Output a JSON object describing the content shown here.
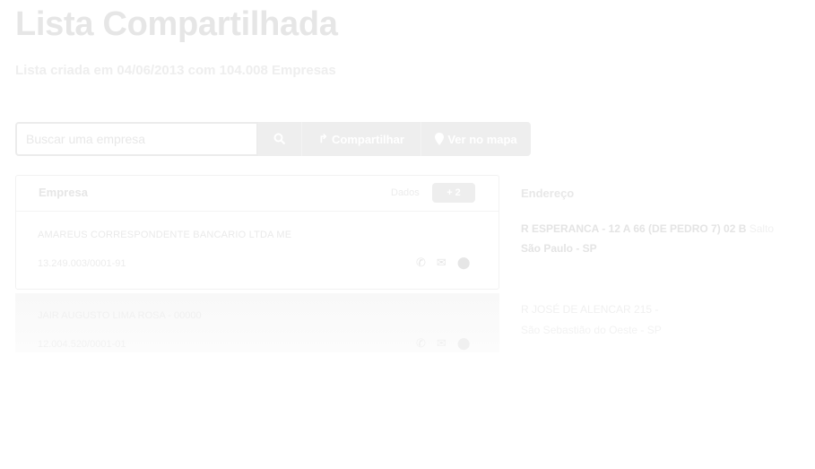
{
  "header": {
    "title": "Lista Compartilhada",
    "subtitle": "Lista criada em 04/06/2013 com 104.008 Empresas"
  },
  "toolbar": {
    "search_placeholder": "Buscar uma empresa",
    "search_icon": "search-icon",
    "share_label": "Compartilhar",
    "share_icon": "share-icon",
    "map_label": "Ver no mapa",
    "map_icon": "map-marker-icon"
  },
  "table": {
    "col_empresa": "Empresa",
    "dados_label": "Dados",
    "dados_badge": "+ 2",
    "col_endereco": "Endereço",
    "rows": [
      {
        "name": "AMAREUS CORRESPONDENTE BANCARIO LTDA ME",
        "cnpj": "13.249.003/0001-91",
        "address_line1": "R ESPERANCA - 12 A 66 (DE PEDRO 7) 02 B",
        "address_line1_extra": "Salto",
        "address_line2": "São Paulo - SP"
      },
      {
        "name": "JAIR AUGUSTO LIMA ROSA - 00000",
        "cnpj": "12.004.520/0001-01",
        "address_line1": "R JOSÉ DE ALENCAR 215 -",
        "address_line1_extra": "",
        "address_line2": "São Sebastião do Oeste - SP"
      }
    ],
    "row_icons": [
      "phone-icon",
      "envelope-icon",
      "user-icon"
    ]
  },
  "colors": {
    "text_faint": "#e6e6e6",
    "button_bg": "#eeeeee",
    "background": "#ffffff"
  }
}
